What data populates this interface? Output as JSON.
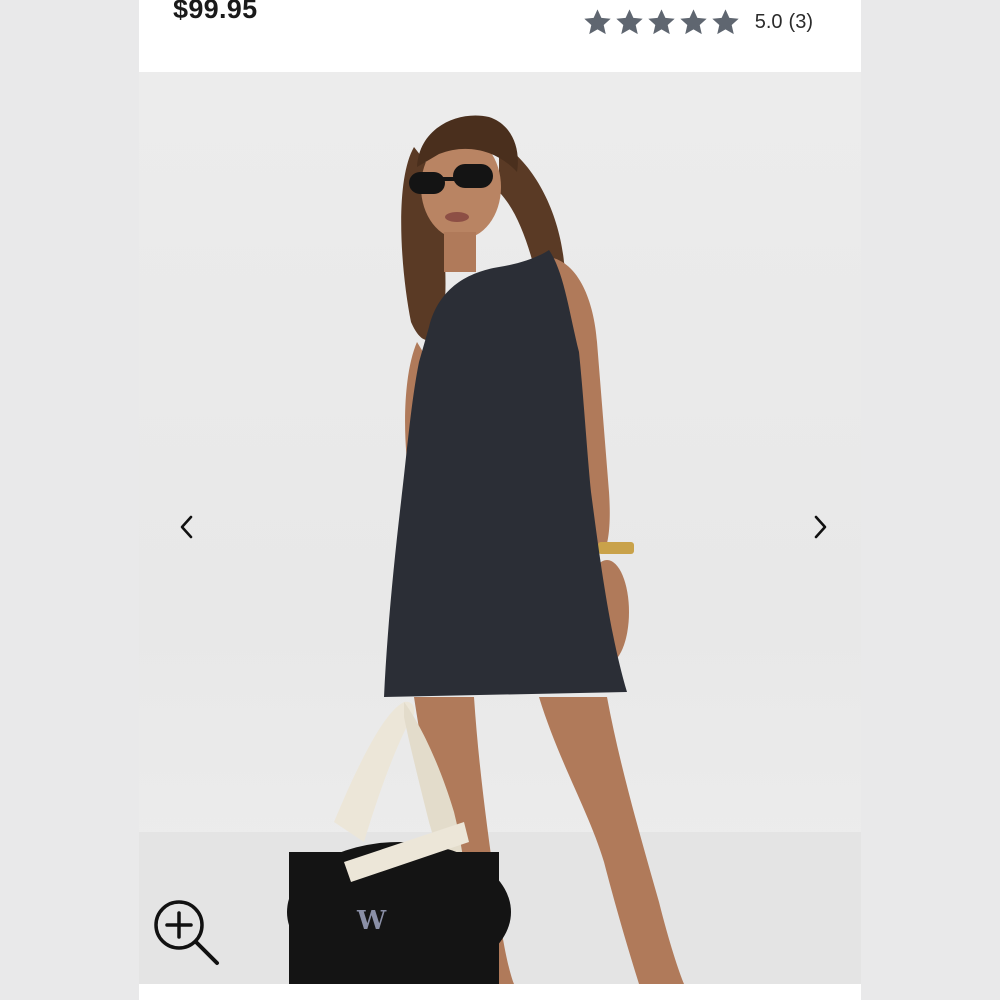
{
  "product": {
    "price": "$99.95"
  },
  "rating": {
    "stars": 5,
    "max_stars": 5,
    "score": "5.0",
    "count": "(3)",
    "star_color": "#5f6670"
  },
  "gallery": {
    "prev_icon": "chevron-left-icon",
    "next_icon": "chevron-right-icon",
    "zoom_icon": "zoom-in-icon",
    "bag_logo": "W"
  },
  "colors": {
    "dress": "#2b2e36",
    "background": "#e9e9ea"
  }
}
